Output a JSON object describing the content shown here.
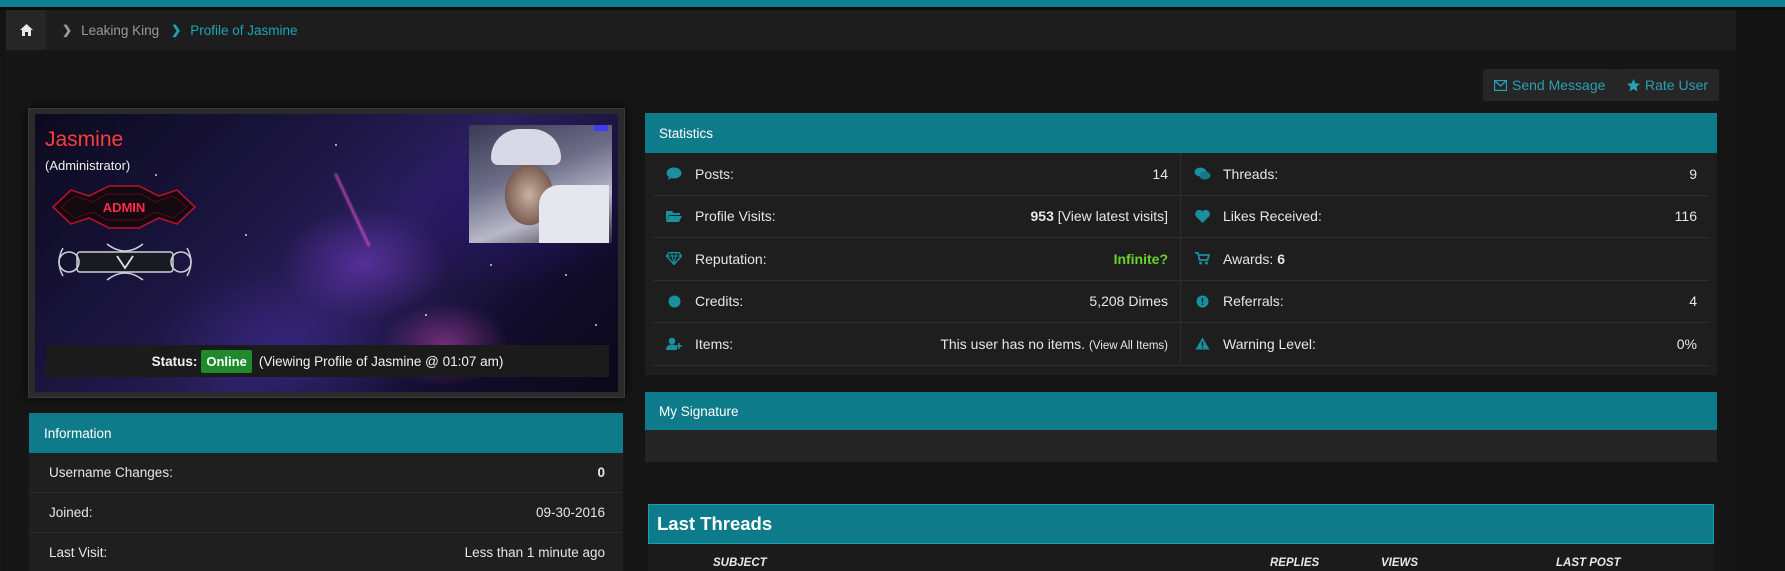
{
  "breadcrumb": {
    "home_icon": "home-icon",
    "items": [
      {
        "label": "Leaking King"
      },
      {
        "label": "Profile of Jasmine"
      }
    ]
  },
  "actions": {
    "send_message": "Send Message",
    "rate_user": "Rate User"
  },
  "profile": {
    "name": "Jasmine",
    "role": "(Administrator)",
    "badge_text": "ADMIN",
    "status_label": "Status:",
    "status_value": "Online",
    "status_detail": "(Viewing Profile of Jasmine @ 01:07 am)"
  },
  "information": {
    "title": "Information",
    "rows": [
      {
        "label": "Username Changes:",
        "value": "0"
      },
      {
        "label": "Joined:",
        "value": "09-30-2016"
      },
      {
        "label": "Last Visit:",
        "value": "Less than 1 minute ago"
      }
    ]
  },
  "statistics": {
    "title": "Statistics",
    "posts": {
      "label": "Posts:",
      "value": "14"
    },
    "threads": {
      "label": "Threads:",
      "value": "9"
    },
    "profile_visits": {
      "label": "Profile Visits:",
      "value": "953",
      "link": "[View latest visits]"
    },
    "likes": {
      "label": "Likes Received:",
      "value": "116"
    },
    "reputation": {
      "label": "Reputation:",
      "value": "Infinite?"
    },
    "awards": {
      "label": "Awards:",
      "value": "6"
    },
    "credits": {
      "label": "Credits:",
      "value": "5,208 Dimes"
    },
    "referrals": {
      "label": "Referrals:",
      "value": "4"
    },
    "items": {
      "label": "Items:",
      "value": "This user has no items.",
      "link": "(View All Items)"
    },
    "warning": {
      "label": "Warning Level:",
      "value": "0%"
    }
  },
  "signature": {
    "title": "My Signature"
  },
  "last_threads": {
    "title": "Last Threads",
    "columns": [
      "SUBJECT",
      "REPLIES",
      "VIEWS",
      "LAST POST"
    ]
  },
  "colors": {
    "accent": "#0d7b89",
    "link": "#2b9fb3",
    "online": "#1f8a2b",
    "reputation": "#6bd22c",
    "name": "#ff3d3d"
  }
}
